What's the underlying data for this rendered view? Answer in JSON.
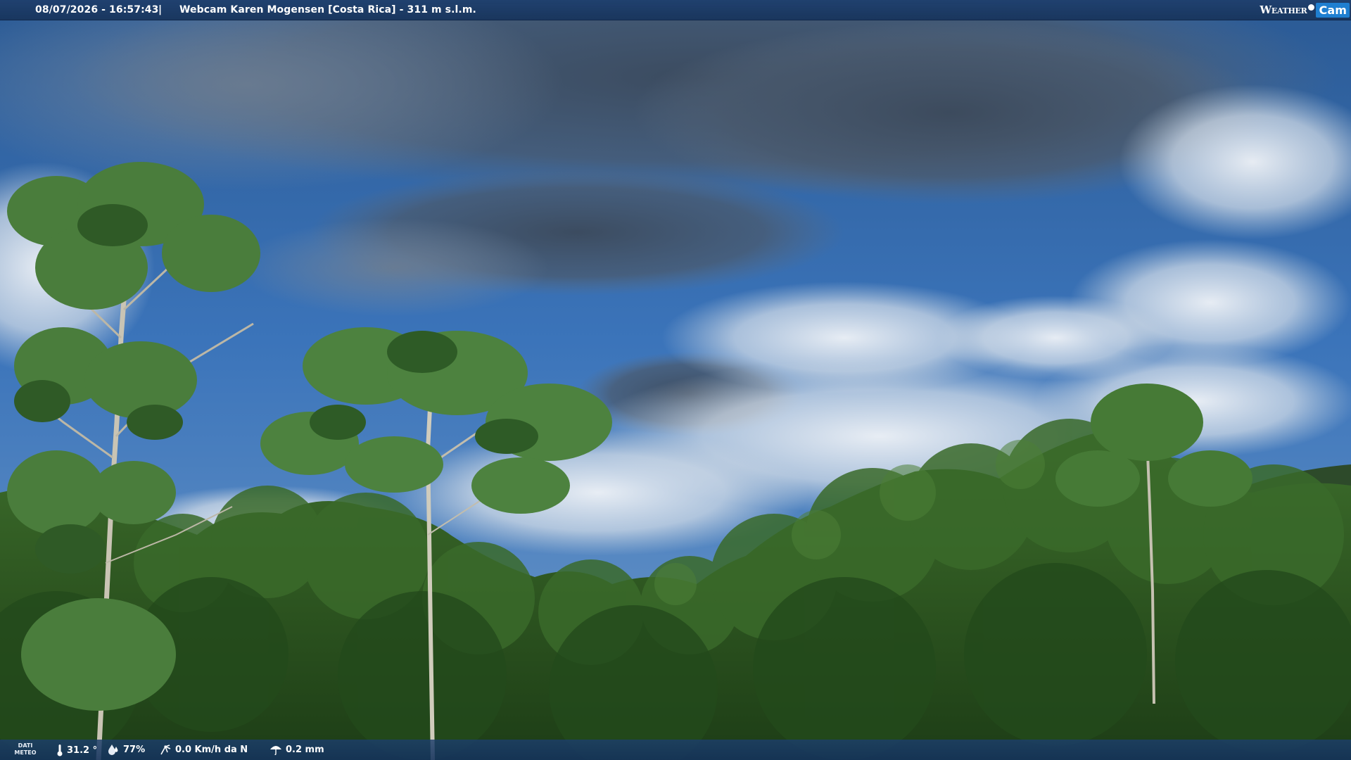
{
  "header": {
    "datetime": "08/07/2026 - 16:57:43",
    "separator": "|",
    "title": "Webcam Karen Mogensen [Costa Rica] - 311 m s.l.m.",
    "logo_weather": "Weather",
    "logo_cam": "Cam"
  },
  "footer": {
    "dati_line1": "DATI",
    "dati_line2": "METEO",
    "temperature": "31.2 °",
    "humidity": "77%",
    "wind": "0.0 Km/h da N",
    "rain": "0.2 mm"
  },
  "icons": {
    "temperature": "thermometer-icon",
    "humidity": "humidity-drop-icon",
    "wind": "wind-icon",
    "rain": "rain-umbrella-icon"
  },
  "colors": {
    "bar": "#1c3e6c",
    "sky": "#3a72b8",
    "foliage": "#2f5a22",
    "logo_accent": "#1f7fd1"
  }
}
